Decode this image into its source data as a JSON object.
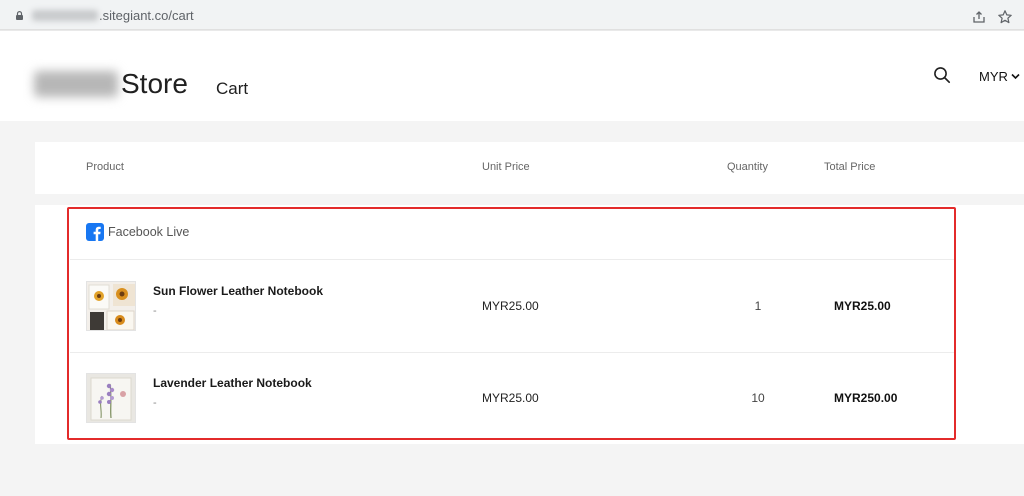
{
  "browser": {
    "url_host": ".sitegiant.co/cart"
  },
  "header": {
    "store_name": "Store",
    "page_title": "Cart",
    "currency": "MYR"
  },
  "table": {
    "columns": {
      "product": "Product",
      "unit_price": "Unit Price",
      "quantity": "Quantity",
      "total_price": "Total Price"
    }
  },
  "cart": {
    "group_label": "Facebook Live",
    "items": [
      {
        "name": "Sun Flower Leather Notebook",
        "variant": "-",
        "unit_price": "MYR25.00",
        "quantity": "1",
        "total": "MYR25.00"
      },
      {
        "name": "Lavender Leather Notebook",
        "variant": "-",
        "unit_price": "MYR25.00",
        "quantity": "10",
        "total": "MYR250.00"
      }
    ]
  },
  "colors": {
    "highlight": "#e32b2b",
    "facebook": "#1877f2"
  }
}
